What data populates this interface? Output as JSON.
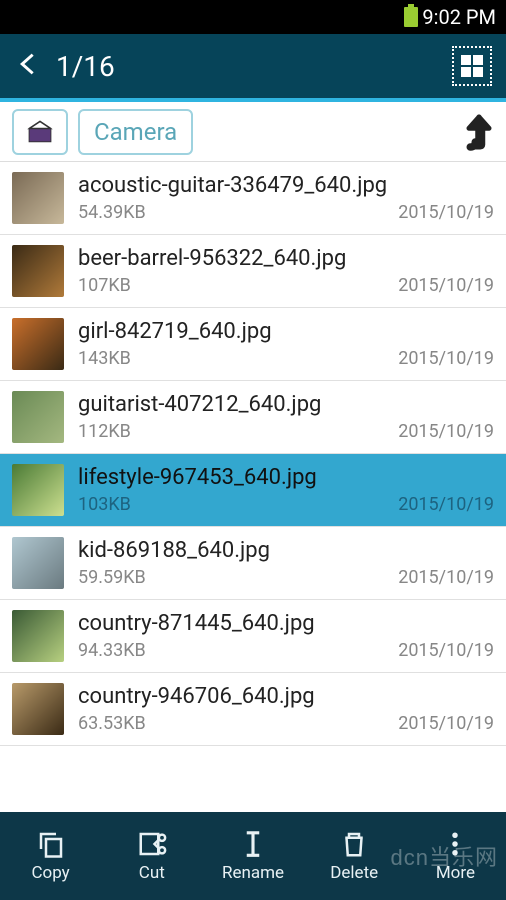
{
  "statusbar": {
    "time": "9:02 PM"
  },
  "appbar": {
    "counter": "1/16"
  },
  "breadcrumb": {
    "folder": "Camera"
  },
  "files": [
    {
      "name": "acoustic-guitar-336479_640.jpg",
      "size": "54.39KB",
      "date": "2015/10/19",
      "thumbClass": "t0",
      "selected": false
    },
    {
      "name": "beer-barrel-956322_640.jpg",
      "size": "107KB",
      "date": "2015/10/19",
      "thumbClass": "t1",
      "selected": false
    },
    {
      "name": "girl-842719_640.jpg",
      "size": "143KB",
      "date": "2015/10/19",
      "thumbClass": "t2",
      "selected": false
    },
    {
      "name": "guitarist-407212_640.jpg",
      "size": "112KB",
      "date": "2015/10/19",
      "thumbClass": "t3",
      "selected": false
    },
    {
      "name": "lifestyle-967453_640.jpg",
      "size": "103KB",
      "date": "2015/10/19",
      "thumbClass": "t4",
      "selected": true
    },
    {
      "name": "kid-869188_640.jpg",
      "size": "59.59KB",
      "date": "2015/10/19",
      "thumbClass": "t5",
      "selected": false
    },
    {
      "name": "country-871445_640.jpg",
      "size": "94.33KB",
      "date": "2015/10/19",
      "thumbClass": "t6",
      "selected": false
    },
    {
      "name": "country-946706_640.jpg",
      "size": "63.53KB",
      "date": "2015/10/19",
      "thumbClass": "t7",
      "selected": false
    }
  ],
  "toolbar": {
    "copy": "Copy",
    "cut": "Cut",
    "rename": "Rename",
    "delete": "Delete",
    "more": "More"
  },
  "watermark": "dcn当乐网"
}
